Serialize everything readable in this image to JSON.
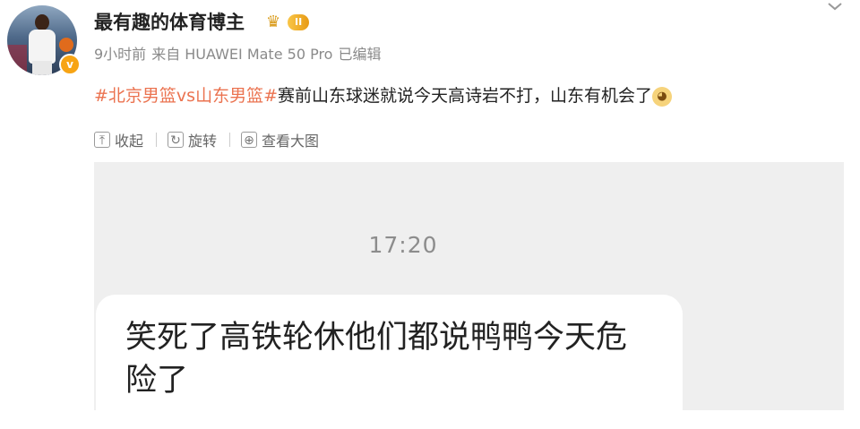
{
  "user": {
    "name": "最有趣的体育博主",
    "level_badge": "II",
    "verified_mark": "v"
  },
  "meta": {
    "time": "9小时前",
    "source": "来自 HUAWEI Mate 50 Pro",
    "edited": "已编辑"
  },
  "post": {
    "hashtag": "#北京男篮vs山东男篮#",
    "text": "赛前山东球迷就说今天高诗岩不打，山东有机会了",
    "emoji": "doge-emoji"
  },
  "actions": {
    "favorite_label": "收起",
    "rotate_label": "旋转",
    "view_large_label": "查看大图"
  },
  "chat": {
    "time": "17:20",
    "message": "笑死了高铁轮休他们都说鸭鸭今天危险了"
  },
  "icons": {
    "crown": "crown-icon",
    "chevron": "chevron-down-icon",
    "collapse": "collapse-icon",
    "rotate": "rotate-icon",
    "zoom": "view-large-icon"
  },
  "colors": {
    "hashtag": "#eb7350",
    "badge": "#f7a414",
    "chat_bg": "#efefef"
  }
}
